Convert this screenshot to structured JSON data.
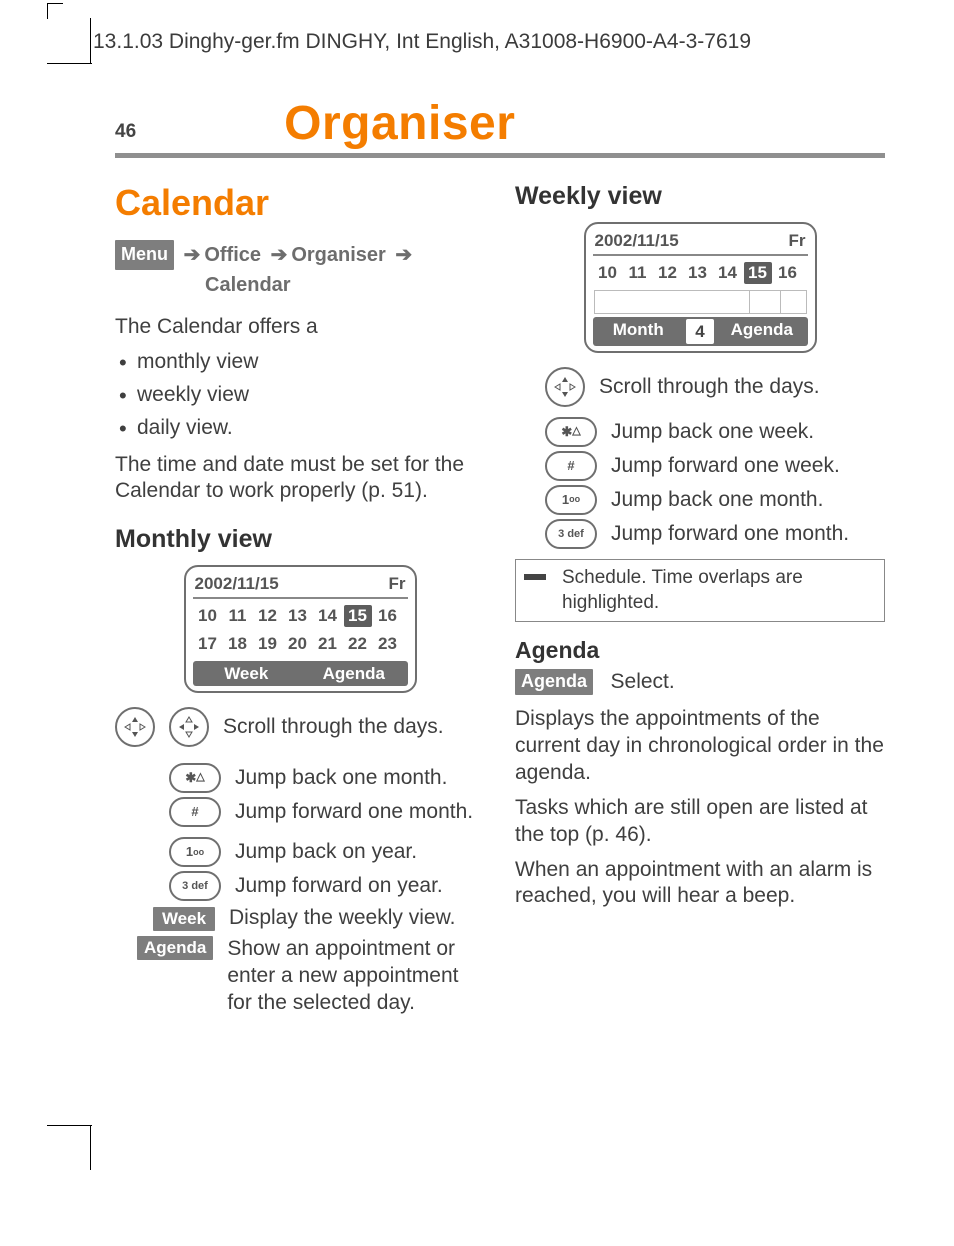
{
  "runhead": "13.1.03    Dinghy-ger.fm      DINGHY, Int English, A31008-H6900-A4-3-7619",
  "page_number": "46",
  "chapter_title": "Organiser",
  "left": {
    "section_title": "Calendar",
    "crumb": {
      "menu": "Menu",
      "office": "Office",
      "organiser": "Organiser",
      "calendar": "Calendar"
    },
    "intro": "The Calendar offers a",
    "bullets": [
      "monthly view",
      "weekly view",
      "daily view."
    ],
    "note": "The time and date must be set for the Calendar to work properly (p. 51).",
    "monthly_heading": "Monthly view",
    "phone": {
      "date": "2002/11/15",
      "dow": "Fr",
      "days_row1": [
        "10",
        "11",
        "12",
        "13",
        "14",
        "15",
        "16"
      ],
      "days_row2": [
        "17",
        "18",
        "19",
        "20",
        "21",
        "22",
        "23"
      ],
      "soft_left": "Week",
      "soft_right": "Agenda"
    },
    "legend": {
      "nav_scroll": "Scroll through the days.",
      "star": "Jump back one month.",
      "hash": "Jump forward one month.",
      "one": "Jump back on year.",
      "three": "Jump forward on year.",
      "week": "Display the weekly view.",
      "week_label": "Week",
      "agenda": "Show an appointment or enter a new appoint­ment for the selected day.",
      "agenda_label": "Agenda"
    }
  },
  "right": {
    "weekly_heading": "Weekly view",
    "phone": {
      "date": "2002/11/15",
      "dow": "Fr",
      "days_row1": [
        "10",
        "11",
        "12",
        "13",
        "14",
        "15",
        "16"
      ],
      "soft_left": "Month",
      "soft_mid": "4",
      "soft_right": "Agenda"
    },
    "legend": {
      "nav_scroll": "Scroll through the days.",
      "star": "Jump back one week.",
      "hash": "Jump forward one week.",
      "one": "Jump back one month.",
      "three": "Jump forward one month."
    },
    "note_box": "Schedule. Time overlaps are highlighted.",
    "agenda_heading": "Agenda",
    "agenda_pill": "Agenda",
    "agenda_select": "Select.",
    "para1": "Displays the appointments of the current day in chronological order in the agenda.",
    "para2": "Tasks which are still open are listed at the top (p. 46).",
    "para3": "When an appointment with an alarm is reached, you will hear a beep."
  },
  "icons": {
    "star": "✱",
    "hash": "#",
    "one": "1",
    "three": "3 def",
    "oo": "oo",
    "tri": "△"
  }
}
